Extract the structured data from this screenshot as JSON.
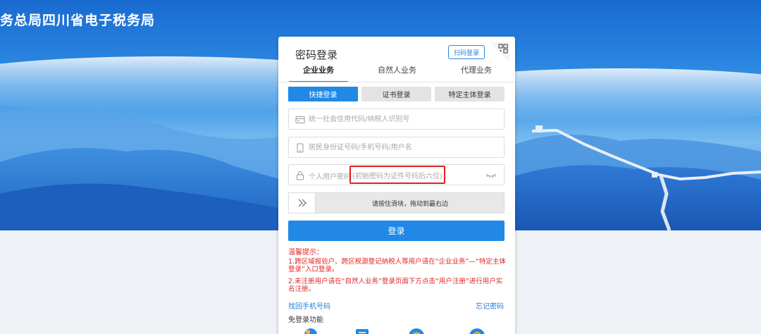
{
  "site": {
    "title": "务总局四川省电子税务局"
  },
  "colors": {
    "accent": "#2189e5",
    "warning": "#e02424",
    "link": "#1f7fd6"
  },
  "card": {
    "title": "密码登录",
    "qr_login_label": "扫码登录",
    "qr_icon": "qr-code-icon",
    "tabs": [
      {
        "label": "企业业务",
        "active": true
      },
      {
        "label": "自然人业务",
        "active": false
      },
      {
        "label": "代理业务",
        "active": false
      }
    ],
    "modes": [
      {
        "label": "快捷登录",
        "active": true
      },
      {
        "label": "证书登录",
        "active": false
      },
      {
        "label": "特定主体登录",
        "active": false
      }
    ],
    "fields": {
      "credit_code": {
        "placeholder": "统一社会信用代码/纳税人识别号",
        "value": "",
        "icon": "id-card-icon"
      },
      "user_id": {
        "placeholder": "居民身份证号码/手机号码/用户名",
        "value": "",
        "icon": "phone-icon"
      },
      "password": {
        "label": "个人用户密码",
        "hint": "(初始密码为证件号码后六位)",
        "value": "",
        "icon": "lock-icon",
        "toggle_icon": "eye-closed-icon"
      }
    },
    "slider": {
      "text": "请按住滑块，拖动到最右边",
      "handle_icon": "double-chevron-right-icon"
    },
    "login_button": "登录",
    "tips": {
      "title": "温馨提示：",
      "items": [
        "1.跨区域报验户、跨区税源登记纳税人等用户请在“企业业务”—“特定主体登录”入口登录。",
        "2.未注册用户请在“自然人业务”登录页面下方点击“用户注册”进行用户实名注册。"
      ]
    },
    "links": {
      "recover_phone": "找回手机号码",
      "forgot_password": "忘记密码"
    },
    "free_login": {
      "label": "免登录功能"
    }
  }
}
